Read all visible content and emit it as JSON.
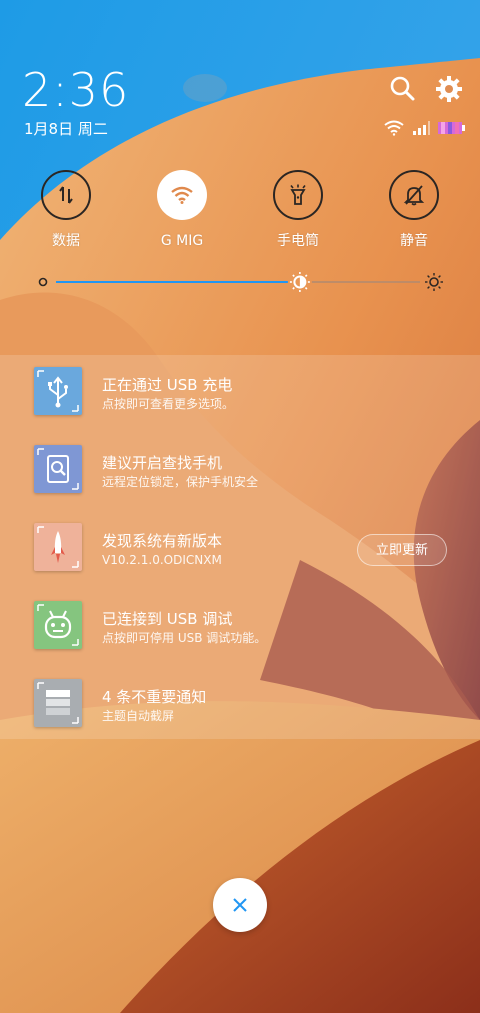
{
  "status": {
    "time": "2:36",
    "date": "1月8日 周二"
  },
  "header_icons": {
    "search": "search-icon",
    "settings": "gear-icon"
  },
  "quick_toggles": [
    {
      "label": "数据",
      "icon": "data-arrows-icon",
      "active": false
    },
    {
      "label": "G  MIG",
      "icon": "wifi-icon",
      "active": true
    },
    {
      "label": "手电筒",
      "icon": "flashlight-icon",
      "active": false
    },
    {
      "label": "静音",
      "icon": "bell-off-icon",
      "active": false
    }
  ],
  "brightness": {
    "level": 0.67,
    "auto_icon": "auto-brightness-icon",
    "max_icon": "sun-icon"
  },
  "notifications": [
    {
      "title": "正在通过 USB 充电",
      "subtitle": "点按即可查看更多选项。",
      "icon": "usb-icon",
      "icon_color": "#6aa8dd"
    },
    {
      "title": "建议开启查找手机",
      "subtitle": "远程定位锁定，保护手机安全",
      "icon": "find-phone-icon",
      "icon_color": "#7f97d4"
    },
    {
      "title": "发现系统有新版本",
      "subtitle": "V10.2.1.0.ODICNXM",
      "icon": "update-rocket-icon",
      "icon_color": "#efb29a",
      "action": "立即更新"
    },
    {
      "title": "已连接到 USB 调试",
      "subtitle": "点按即可停用 USB 调试功能。",
      "icon": "android-icon",
      "icon_color": "#85c57f"
    },
    {
      "title": "4 条不重要通知",
      "subtitle": "主题自动截屏",
      "icon": "stack-icon",
      "icon_color": "#a9adb1"
    }
  ],
  "close_icon": "close-icon",
  "colors": {
    "sky_top": "#1d8fe4",
    "sand": "#e08d52",
    "accent": "#2196f3"
  }
}
